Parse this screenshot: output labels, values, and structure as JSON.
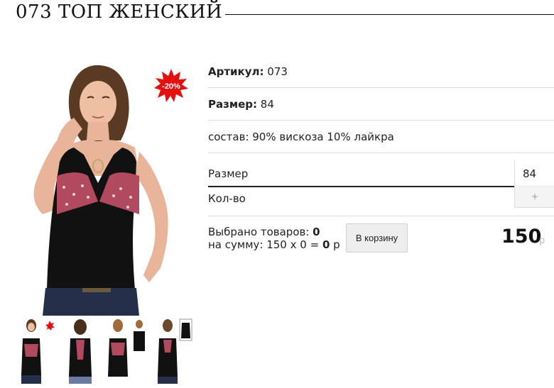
{
  "product": {
    "title": "073 ТОП ЖЕНСКИЙ",
    "discount_badge": "-20%",
    "article_label": "Артикул:",
    "article_value": "073",
    "size_label": "Размер:",
    "size_value": "84",
    "composition": "состав: 90% вискоза 10% лайкра"
  },
  "options": {
    "size_label": "Размер",
    "size_value": "84",
    "qty_label": "Кол-во",
    "qty_plus": "+"
  },
  "summary": {
    "selected_label": "Выбрано товаров:",
    "selected_count": "0",
    "sum_label": "на сумму: 150 x 0 =",
    "sum_value": "0",
    "sum_currency": "р",
    "cart_button": "В корзину"
  },
  "price": {
    "value": "150",
    "currency": "р"
  },
  "colors": {
    "badge": "#e41010",
    "top_black": "#111111",
    "floral": "#b14a5e",
    "button_bg": "#eeeeee"
  },
  "icons": [
    "discount-star-icon",
    "plus-icon"
  ]
}
